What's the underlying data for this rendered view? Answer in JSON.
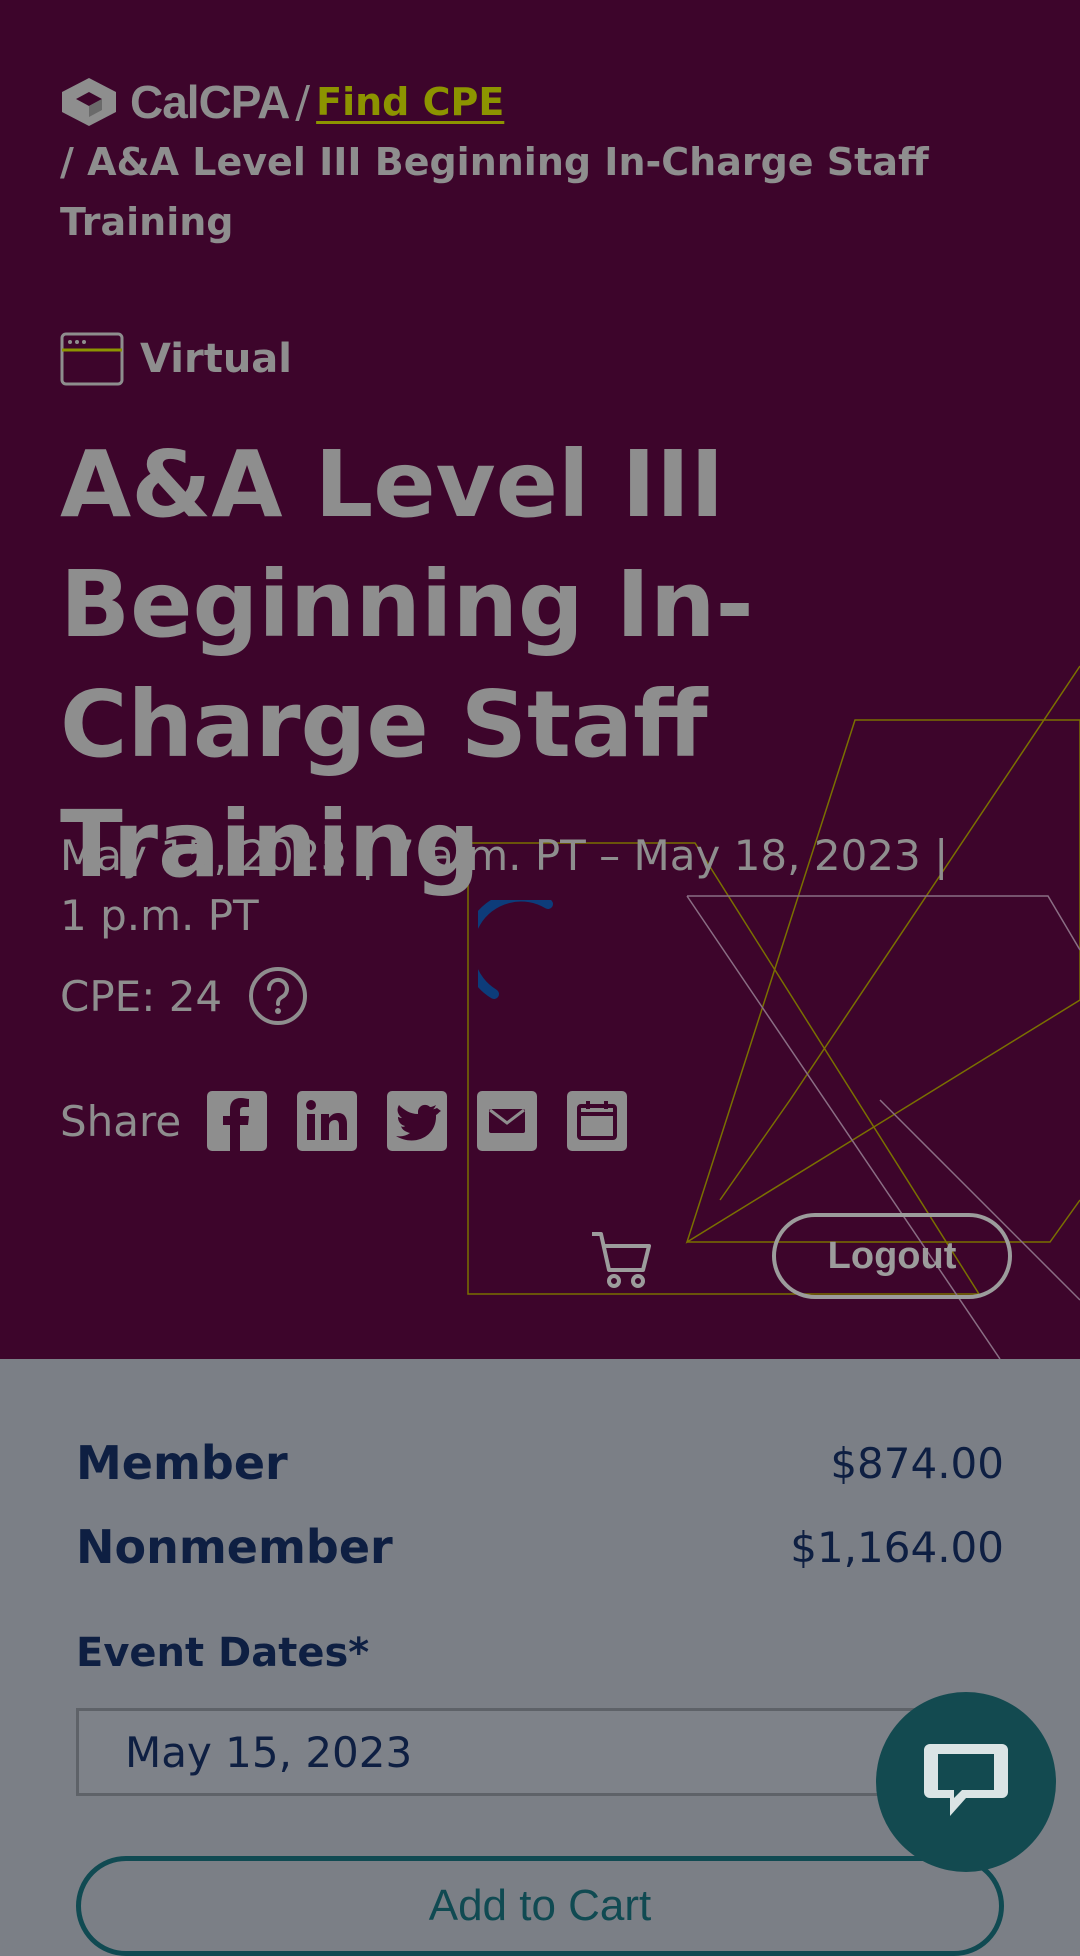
{
  "header": {
    "brand": "CalCPA",
    "separator": "/",
    "find_cpe_link": "Find CPE",
    "breadcrumb_current": "/ A&A Level III Beginning In-Charge Staff Training"
  },
  "event": {
    "format_label": "Virtual",
    "title": "A&A Level III Beginning In-Charge Staff Training",
    "date_range": "May 15, 2023 | 7 a.m. PT – May 18, 2023 | 1 p.m. PT",
    "cpe_label": "CPE: 24"
  },
  "share": {
    "label": "Share",
    "buttons": [
      "facebook-icon",
      "linkedin-icon",
      "twitter-icon",
      "email-icon",
      "calendar-icon"
    ]
  },
  "actions": {
    "logout_label": "Logout"
  },
  "pricing": {
    "member_label": "Member",
    "member_price": "$874.00",
    "nonmember_label": "Nonmember",
    "nonmember_price": "$1,164.00"
  },
  "registration": {
    "event_dates_label": "Event Dates*",
    "selected_date": "May 15, 2023",
    "add_to_cart_label": "Add to Cart"
  },
  "colors": {
    "hero_bg": "#3d052b",
    "link": "#8c9400",
    "panel_bg": "#7b7f86",
    "text_dark": "#0e1f42",
    "accent_teal": "#134a50",
    "spinner": "#0d3c7a"
  }
}
